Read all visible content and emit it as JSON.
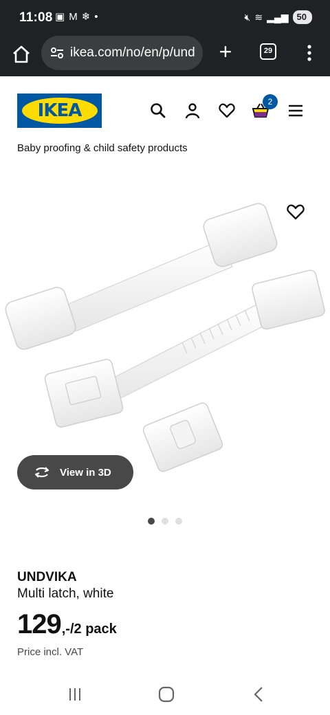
{
  "status_bar": {
    "time": "11:08",
    "left_icons": [
      "screenshot-icon",
      "gmail-icon",
      "snowflake-icon",
      "dot-icon"
    ],
    "battery": "50"
  },
  "browser": {
    "url": "ikea.com/no/en/p/und",
    "tab_count": "29"
  },
  "header": {
    "logo_text": "IKEA",
    "cart_count": "2"
  },
  "breadcrumb": "Baby proofing & child safety products",
  "gallery": {
    "view_3d_label": "View in 3D",
    "image_count": 3,
    "active_index": 0
  },
  "product": {
    "name": "UNDVIKA",
    "description": "Multi latch, white",
    "price_main": "129",
    "price_suffix": ",-/2 pack",
    "price_note": "Price incl. VAT"
  },
  "colors": {
    "ikea_blue": "#0058a3",
    "ikea_yellow": "#ffdb00",
    "chrome_bg": "#202124"
  }
}
